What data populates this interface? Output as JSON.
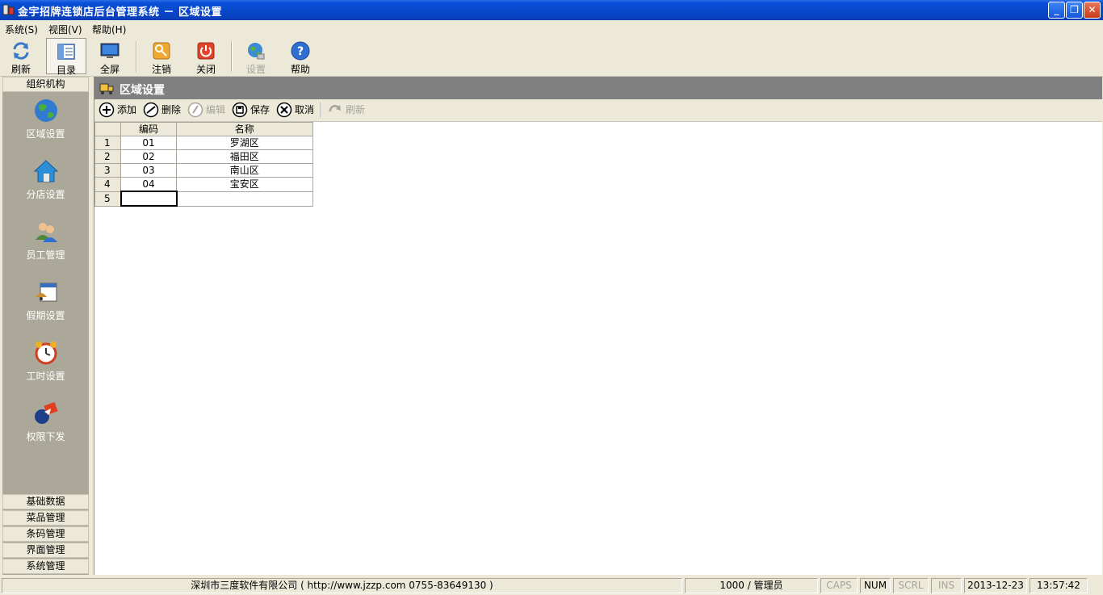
{
  "window": {
    "title": "金宇招牌连锁店后台管理系统 － 区域设置",
    "controls": {
      "minimize": "_",
      "maximize": "❐",
      "close": "✕"
    }
  },
  "menu": [
    "系统(S)",
    "视图(V)",
    "帮助(H)"
  ],
  "toolbar": {
    "refresh": "刷新",
    "directory": "目录",
    "fullscreen": "全屏",
    "logout": "注销",
    "close": "关闭",
    "settings": "设置",
    "help": "帮助"
  },
  "sidebar": {
    "top_group": "组织机构",
    "items": [
      "区域设置",
      "分店设置",
      "员工管理",
      "假期设置",
      "工时设置",
      "权限下发"
    ],
    "bottom_groups": [
      "基础数据",
      "菜品管理",
      "条码管理",
      "界面管理",
      "系统管理"
    ]
  },
  "panel": {
    "title": "区域设置",
    "actions": {
      "add": "添加",
      "delete": "删除",
      "edit": "编辑",
      "save": "保存",
      "cancel": "取消",
      "refresh": "刷新"
    }
  },
  "grid": {
    "columns": [
      "编码",
      "名称"
    ],
    "rows": [
      {
        "num": "1",
        "code": "01",
        "name": "罗湖区"
      },
      {
        "num": "2",
        "code": "02",
        "name": "福田区"
      },
      {
        "num": "3",
        "code": "03",
        "name": "南山区"
      },
      {
        "num": "4",
        "code": "04",
        "name": "宝安区"
      },
      {
        "num": "5",
        "code": "",
        "name": ""
      }
    ]
  },
  "status": {
    "company": "深圳市三度软件有限公司 ( http://www.jzzp.com  0755-83649130 )",
    "user": "1000 / 管理员",
    "caps": "CAPS",
    "num": "NUM",
    "scrl": "SCRL",
    "ins": "INS",
    "date": "2013-12-23",
    "time": "13:57:42"
  }
}
